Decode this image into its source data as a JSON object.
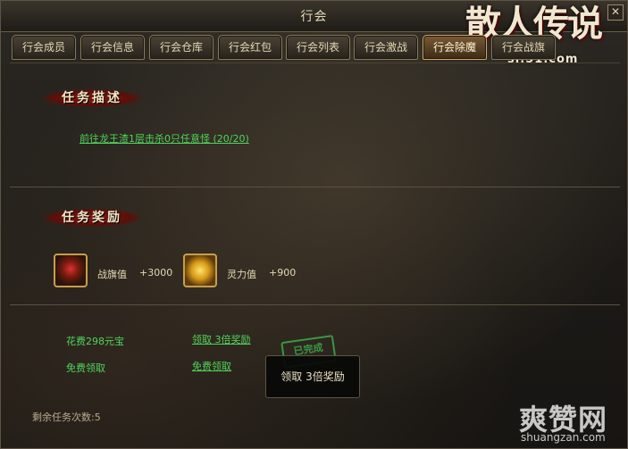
{
  "window": {
    "title": "行会"
  },
  "brand": {
    "logo_text": "散人传说",
    "sub": "sr.51.com"
  },
  "tabs": [
    {
      "label": "行会成员"
    },
    {
      "label": "行会信息"
    },
    {
      "label": "行会仓库"
    },
    {
      "label": "行会红包"
    },
    {
      "label": "行会列表"
    },
    {
      "label": "行会激战"
    },
    {
      "label": "行会除魔",
      "active": true
    },
    {
      "label": "行会战旗"
    }
  ],
  "description": {
    "header": "任务描述",
    "quest": "前往龙王渣1层击杀0只任意怪 (20/20)"
  },
  "rewards": {
    "header": "任务奖励",
    "items": [
      {
        "icon": "flag-icon",
        "label": "战旗值",
        "value": "+3000"
      },
      {
        "icon": "spirit-orb-icon",
        "label": "灵力值",
        "value": "+900"
      }
    ]
  },
  "claim": {
    "pay_label": "花费298元宝",
    "claim_triple": "领取 3倍奖励",
    "free_label": "免费领取",
    "free_claim": "免费领取",
    "stamp": "已完成",
    "tooltip": "领取 3倍奖励"
  },
  "remaining": "剩余任务次数:5",
  "watermark": {
    "main": "爽赞网",
    "sub": "shuangzan.com"
  }
}
